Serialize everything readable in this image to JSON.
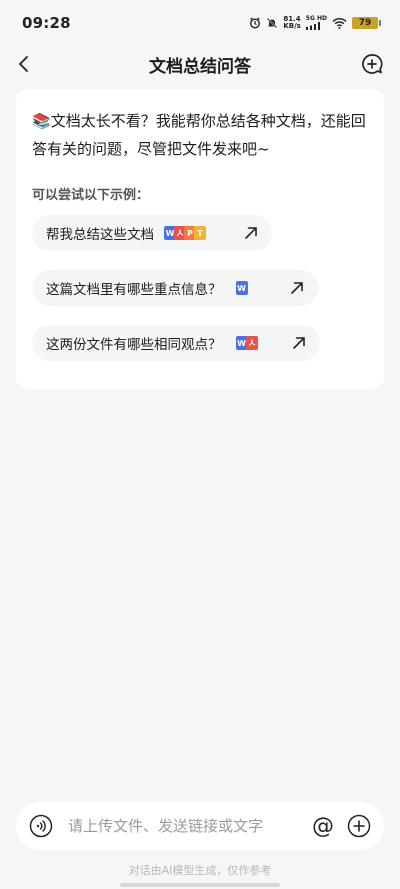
{
  "status_bar": {
    "time": "09:28",
    "net_speed_value": "81.4",
    "net_speed_unit": "KB/s",
    "network_type": "5G HD",
    "battery": "79"
  },
  "header": {
    "title": "文档总结问答"
  },
  "card": {
    "intro_emoji": "📚",
    "intro_text": "文档太长不看？我能帮你总结各种文档，还能回答有关的问题，尽管把文件发来吧~",
    "try_label": "可以尝试以下示例：",
    "examples": [
      {
        "text": "帮我总结这些文档",
        "file_icons": [
          "W",
          "P",
          "P",
          "T"
        ]
      },
      {
        "text": "这篇文档里有哪些重点信息？",
        "file_icons": [
          "W"
        ]
      },
      {
        "text": "这两份文件有哪些相同观点？",
        "file_icons": [
          "W",
          "P"
        ]
      }
    ]
  },
  "input_bar": {
    "placeholder": "请上传文件、发送链接或文字",
    "at_symbol": "@"
  },
  "footer": {
    "disclaimer": "对话由AI模型生成，仅作参考"
  },
  "colors": {
    "word": "#4a72e8",
    "pdf": "#e8534a",
    "ppt": "#f07b3f",
    "txt": "#f2b233",
    "background": "#f5f6f8"
  }
}
